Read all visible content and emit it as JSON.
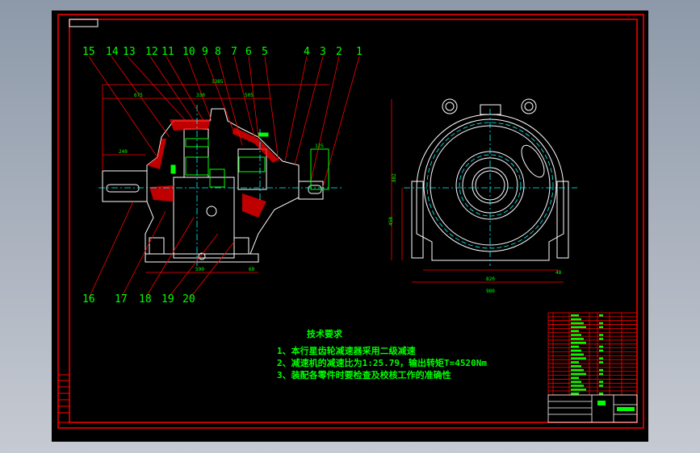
{
  "colors": {
    "background": "#000000",
    "frame": "#ff0000",
    "outline": "#ffffff",
    "centerline": "#00ffff",
    "text": "#00ff00",
    "hatch": "#ff0000"
  },
  "part_numbers": [
    "15",
    "14",
    "13",
    "12",
    "11",
    "10",
    "9",
    "8",
    "7",
    "6",
    "5",
    "4",
    "3",
    "2",
    "1"
  ],
  "bottom_part_numbers": [
    "16",
    "17",
    "18",
    "19",
    "20"
  ],
  "dimensions": {
    "total_length": "1385",
    "d675": "675",
    "d330": "330",
    "d505": "505",
    "d240": "240",
    "d125": "125",
    "d590": "590",
    "d60": "60",
    "height": "882",
    "center_height": "450",
    "d820": "820",
    "d980": "980",
    "d48": "48"
  },
  "technical_requirements": {
    "title": "技术要求",
    "items": [
      "1、本行星齿轮减速器采用二级减速",
      "2、减速机的减速比为1:25.79，输出转矩T=4520Nm",
      "3、装配各零件时要检查及校核工作的准确性"
    ]
  }
}
